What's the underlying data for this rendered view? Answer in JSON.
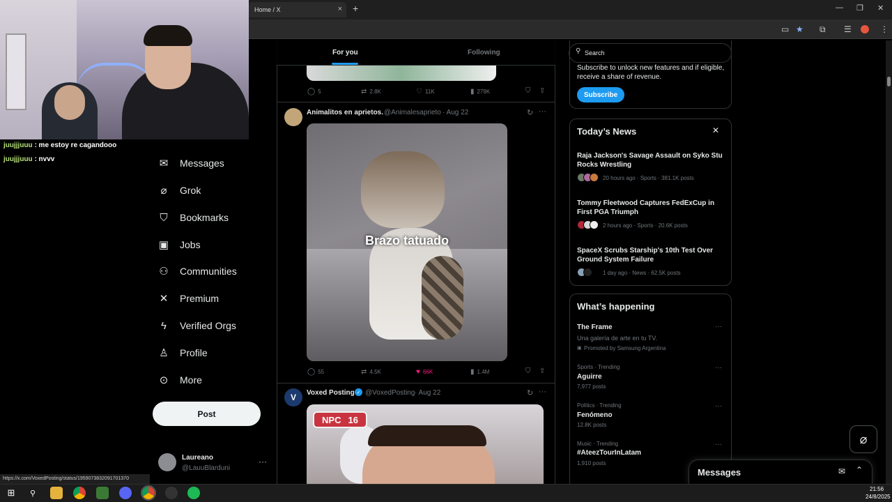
{
  "browser": {
    "tab_title": "Home / X",
    "tab_close": "×",
    "new_tab": "+",
    "minimize": "—",
    "restore": "❐",
    "close": "✕"
  },
  "stream_chat": [
    {
      "user": "juujjjuuu",
      "message": ": me estoy re cagandooo"
    },
    {
      "user": "juujjjuuu",
      "message": ": nvvv"
    }
  ],
  "left_nav": {
    "items": [
      {
        "label": "Messages",
        "icon": "envelope-icon"
      },
      {
        "label": "Grok",
        "icon": "grok-icon"
      },
      {
        "label": "Bookmarks",
        "icon": "bookmark-icon"
      },
      {
        "label": "Jobs",
        "icon": "briefcase-icon"
      },
      {
        "label": "Communities",
        "icon": "people-icon"
      },
      {
        "label": "Premium",
        "icon": "x-logo-icon"
      },
      {
        "label": "Verified Orgs",
        "icon": "lightning-icon"
      },
      {
        "label": "Profile",
        "icon": "person-icon"
      },
      {
        "label": "More",
        "icon": "more-circle-icon"
      }
    ],
    "post_label": "Post",
    "account": {
      "name": "Laureano",
      "handle": "@LauuBlarduni"
    }
  },
  "status_url": "https://x.com/VoxedPosting/status/1959073832091701370",
  "feed": {
    "tabs": {
      "for_you": "For you",
      "following": "Following"
    },
    "prev_post_actions": {
      "replies": "5",
      "reposts": "2.8K",
      "likes": "11K",
      "views": "279K"
    },
    "posts": [
      {
        "name": "Animalitos en aprietos.",
        "handle": "@Animalesaprieto",
        "date": "· Aug 22",
        "image_caption": "Brazo tatuado",
        "actions": {
          "replies": "55",
          "reposts": "4.5K",
          "likes": "66K",
          "views": "1.4M"
        }
      },
      {
        "name": "Voxed Posting",
        "handle": "@VoxedPosting",
        "date": "· Aug 22",
        "image_badge": {
          "left": "NPC",
          "right": "16"
        }
      }
    ]
  },
  "right": {
    "search_placeholder": "Search",
    "premium_text": "Subscribe to unlock new features and if eligible, receive a share of revenue.",
    "subscribe_label": "Subscribe",
    "news": {
      "title": "Today’s News",
      "items": [
        {
          "headline": "Raja Jackson's Savage Assault on Syko Stu Rocks Wrestling",
          "meta": "20 hours ago · Sports · 381.1K posts"
        },
        {
          "headline": "Tommy Fleetwood Captures FedExCup in First PGA Triumph",
          "meta": "2 hours ago · Sports · 20.6K posts"
        },
        {
          "headline": "SpaceX Scrubs Starship's 10th Test Over Ground System Failure",
          "meta": "1 day ago · News · 62.5K posts"
        }
      ]
    },
    "happening": {
      "title": "What’s happening",
      "promoted": {
        "name": "The Frame",
        "desc": "Una galería de arte en tu TV.",
        "by": "Promoted by Samsung Argentina"
      },
      "trends": [
        {
          "context": "Sports · Trending",
          "name": "Aguirre",
          "count": "7,977 posts"
        },
        {
          "context": "Politics · Trending",
          "name": "Fenómeno",
          "count": "12.8K posts"
        },
        {
          "context": "Music · Trending",
          "name": "#AteezTourInLatam",
          "count": "1,910 posts"
        }
      ]
    }
  },
  "messages_drawer": {
    "title": "Messages"
  },
  "taskbar": {
    "time": "21:56",
    "date": "24/8/2025"
  },
  "colors": {
    "accent": "#1d9bf0",
    "background": "#000000",
    "border": "#2f3336",
    "secondary_text": "#71767b"
  }
}
